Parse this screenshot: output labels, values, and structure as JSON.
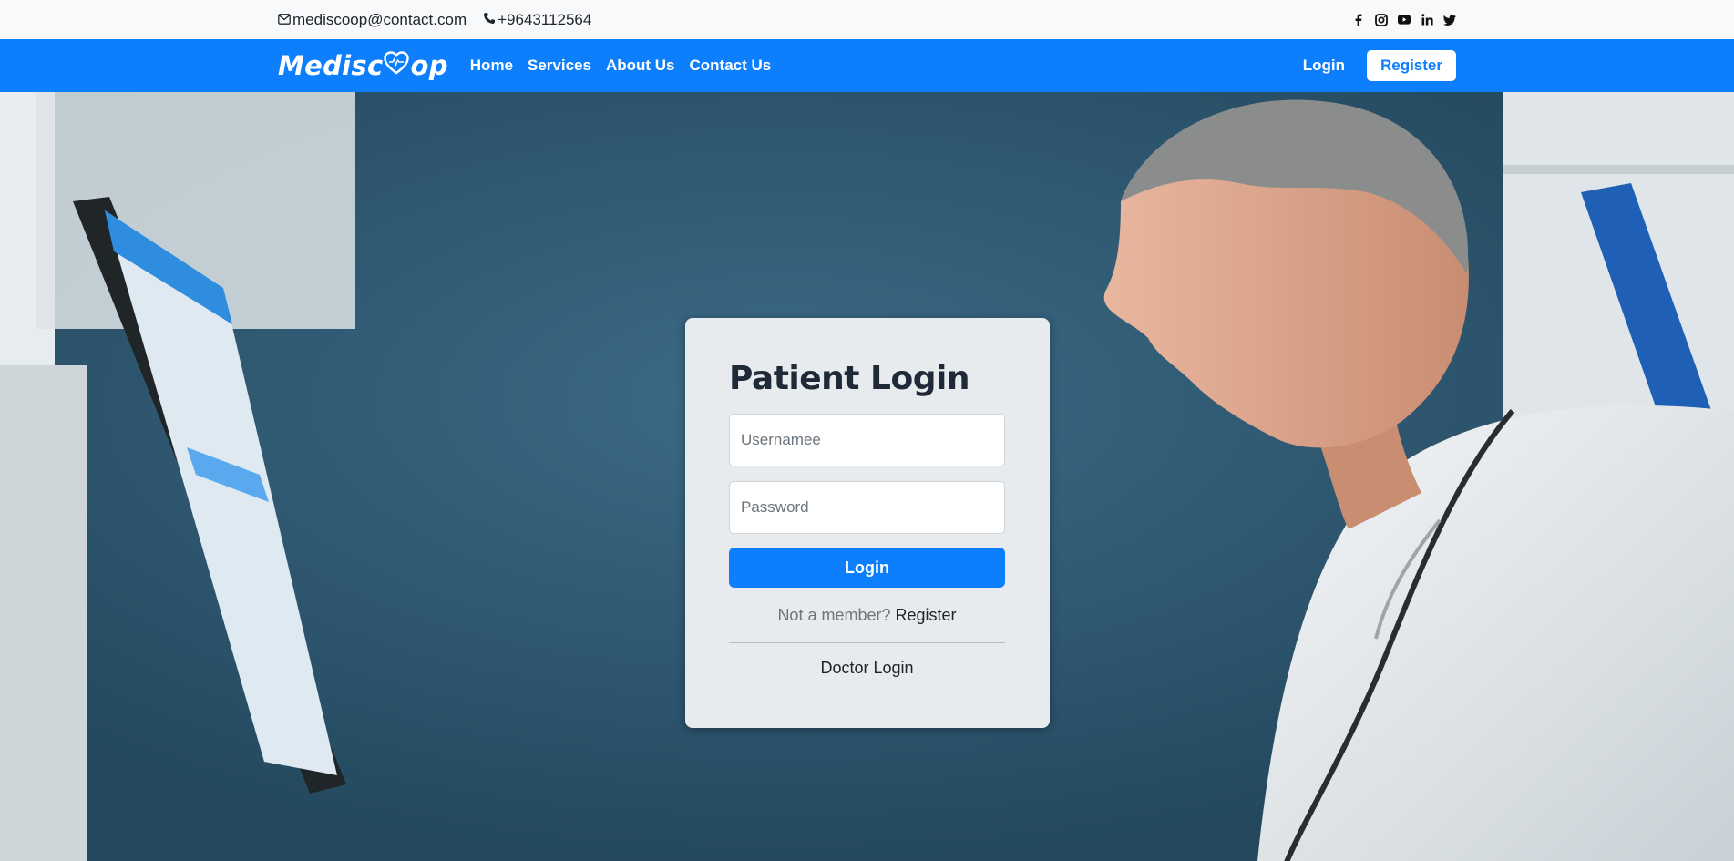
{
  "topbar": {
    "email": "mediscoop@contact.com",
    "phone": "+9643112564",
    "socials": [
      "facebook-icon",
      "instagram-icon",
      "youtube-icon",
      "linkedin-icon",
      "twitter-icon"
    ]
  },
  "navbar": {
    "brand": "Mediscoop",
    "links": [
      "Home",
      "Services",
      "About Us",
      "Contact Us"
    ],
    "login": "Login",
    "register": "Register",
    "color": "#0d7ffc"
  },
  "login_card": {
    "title": "Patient Login",
    "username_placeholder": "Usernamee",
    "password_placeholder": "Password",
    "submit": "Login",
    "member_text": "Not a member?",
    "register_link": "Register",
    "doctor_link": "Doctor Login"
  }
}
